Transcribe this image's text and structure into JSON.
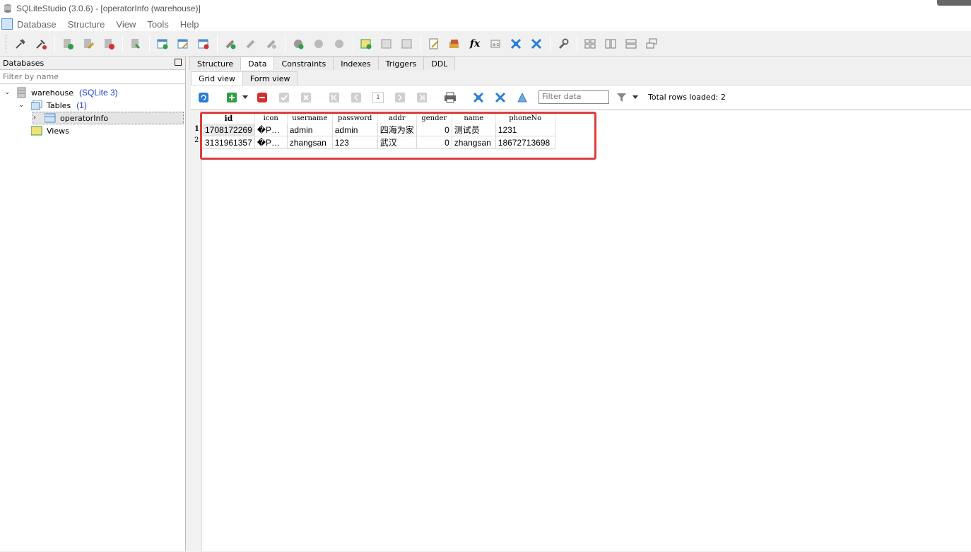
{
  "window": {
    "title": "SQLiteStudio (3.0.6) - [operatorInfo (warehouse)]"
  },
  "menu": [
    "Database",
    "Structure",
    "View",
    "Tools",
    "Help"
  ],
  "databases_panel": {
    "header": "Databases",
    "filter_placeholder": "Filter by name",
    "tree": {
      "db_name": "warehouse",
      "db_type": "(SQLite 3)",
      "tables_label": "Tables",
      "tables_count": "(1)",
      "table_name": "operatorInfo",
      "views_label": "Views"
    }
  },
  "main_tabs": [
    "Structure",
    "Data",
    "Constraints",
    "Indexes",
    "Triggers",
    "DDL"
  ],
  "active_main_tab": "Data",
  "view_tabs": [
    "Grid view",
    "Form view"
  ],
  "active_view_tab": "Grid view",
  "data_toolbar": {
    "page_number": "1",
    "filter_placeholder": "Filter data",
    "total_rows": "Total rows loaded: 2"
  },
  "grid": {
    "columns": [
      "id",
      "icon",
      "username",
      "password",
      "addr",
      "gender",
      "name",
      "phoneNo"
    ],
    "rows": [
      [
        "1708172269",
        "�P…",
        "admin",
        "admin",
        "四海为家",
        "0",
        "测试员",
        "1231"
      ],
      [
        "3131961357",
        "�P…",
        "zhangsan",
        "123",
        "武汉",
        "0",
        "zhangsan",
        "18672713698"
      ]
    ],
    "row_numbers": [
      "1",
      "2"
    ]
  },
  "colors": {
    "highlight": "#e03c3c",
    "sqlite_tag": "#1e40c8",
    "add_green": "#2ea043",
    "delete_red": "#d23030"
  }
}
